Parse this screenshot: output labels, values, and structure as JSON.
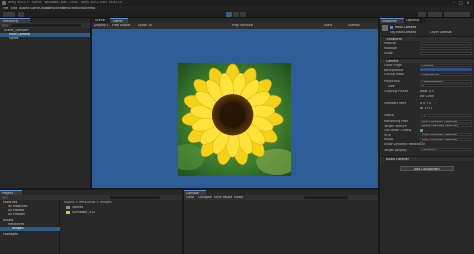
{
  "window": {
    "title": "Unity 2022 3 · Scene · Windows, Mac, Linux · Unity 2022.3.6f1 <DX11>"
  },
  "menu": [
    "File",
    "Edit",
    "Assets",
    "GameObject",
    "Component",
    "Services",
    "Window",
    "Help"
  ],
  "hierarchy": {
    "tab": "Hierarchy",
    "items": [
      "Scene_Sample*",
      "Main Camera",
      "Sprite"
    ]
  },
  "scene": {
    "tabs": [
      "Scene",
      "Game"
    ],
    "toolbar": [
      "Display 1",
      "Free Aspect",
      "Scale",
      "1x",
      "Play Focused",
      "Stats",
      "Gizmos"
    ]
  },
  "inspector": {
    "tabs": [
      "Inspector",
      "Lighting"
    ],
    "object_name": "Main Camera",
    "tag_label": "Tag",
    "tag_value": "MainCamera",
    "layer_label": "Layer",
    "layer_value": "Default",
    "transform_header": "Transform",
    "transform_rows": [
      "Position",
      "Rotation",
      "Scale"
    ],
    "camera_header": "Camera",
    "camera_rows": [
      {
        "label": "Clear Flags",
        "value": "Skybox"
      },
      {
        "label": "Background",
        "value": ""
      },
      {
        "label": "Culling Mask",
        "value": "Everything"
      },
      {
        "label": "Projection",
        "value": "Orthographic"
      },
      {
        "label": "Size",
        "value": "5"
      },
      {
        "label": "Clipping Planes",
        "value": "Near 0.3"
      },
      {
        "label": "",
        "value": "Far 1000"
      },
      {
        "label": "Viewport Rect",
        "value": "X 0  Y 0"
      },
      {
        "label": "",
        "value": "W 1  H 1"
      },
      {
        "label": "Depth",
        "value": "-1"
      },
      {
        "label": "Rendering Path",
        "value": "Use Graphics Settings"
      },
      {
        "label": "Target Texture",
        "value": "None (Render Texture)"
      },
      {
        "label": "Occlusion Culling",
        "value": ""
      },
      {
        "label": "HDR",
        "value": "Use Graphics Settings"
      },
      {
        "label": "MSAA",
        "value": "Use Graphics Settings"
      },
      {
        "label": "Allow Dynamic Resolution",
        "value": ""
      },
      {
        "label": "Target Display",
        "value": "Display 1"
      }
    ],
    "audio_header": "Audio Listener",
    "add_component": "Add Component"
  },
  "project": {
    "tab": "Project",
    "tree": [
      "Favorites",
      "All Materials",
      "All Models",
      "All Prefabs",
      "Assets",
      "Resources",
      "Images",
      "Packages"
    ],
    "breadcrumb": "Assets > Resources > Images",
    "files": [
      "Sprites",
      "sunflower_512"
    ]
  },
  "console": {
    "tab": "Console",
    "toolbar": [
      "Clear",
      "Collapse",
      "Error Pause",
      "Editor"
    ]
  }
}
